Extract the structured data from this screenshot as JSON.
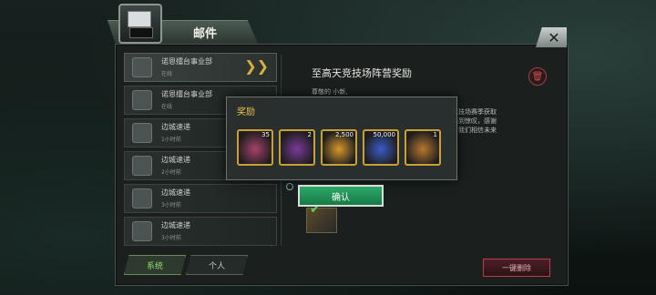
{
  "window": {
    "title": "邮件",
    "close_label": "✕"
  },
  "icons": {
    "mail": "mail-icon",
    "trash": "trash-icon",
    "arrow": "chevron-right-icon"
  },
  "mail_list": [
    {
      "sender": "诺恩擂台事业部",
      "time": "在线",
      "selected": true
    },
    {
      "sender": "诺恩擂台事业部",
      "time": "在线"
    },
    {
      "sender": "边城速递",
      "time": "1小时前"
    },
    {
      "sender": "边城速递",
      "time": "2小时前"
    },
    {
      "sender": "边城速递",
      "time": "3小时前"
    },
    {
      "sender": "边城速递",
      "time": "3小时前"
    },
    {
      "sender": "边城速递",
      "time": ""
    }
  ],
  "detail": {
    "title": "至高天竞技场阵营奖励",
    "greeting": "尊敬的 小新,",
    "lines": [
      "竞技场赛季获取",
      "感到惊叹，感谢",
      "，我们相信未来"
    ]
  },
  "rewards_popup": {
    "title": "奖励",
    "items": [
      {
        "name": "reward-1",
        "count": "35",
        "color": "#a6426a"
      },
      {
        "name": "reward-2",
        "count": "2",
        "color": "#7a3a9a"
      },
      {
        "name": "reward-3",
        "count": "2,500",
        "color": "#d8992c"
      },
      {
        "name": "reward-4",
        "count": "50,000",
        "color": "#3a5bc7"
      },
      {
        "name": "reward-5",
        "count": "1",
        "color": "#b8772e"
      }
    ],
    "confirm_label": "确认"
  },
  "tabs": [
    {
      "label": "系统",
      "active": true
    },
    {
      "label": "个人",
      "active": false
    }
  ],
  "delete_all_label": "一键删除"
}
